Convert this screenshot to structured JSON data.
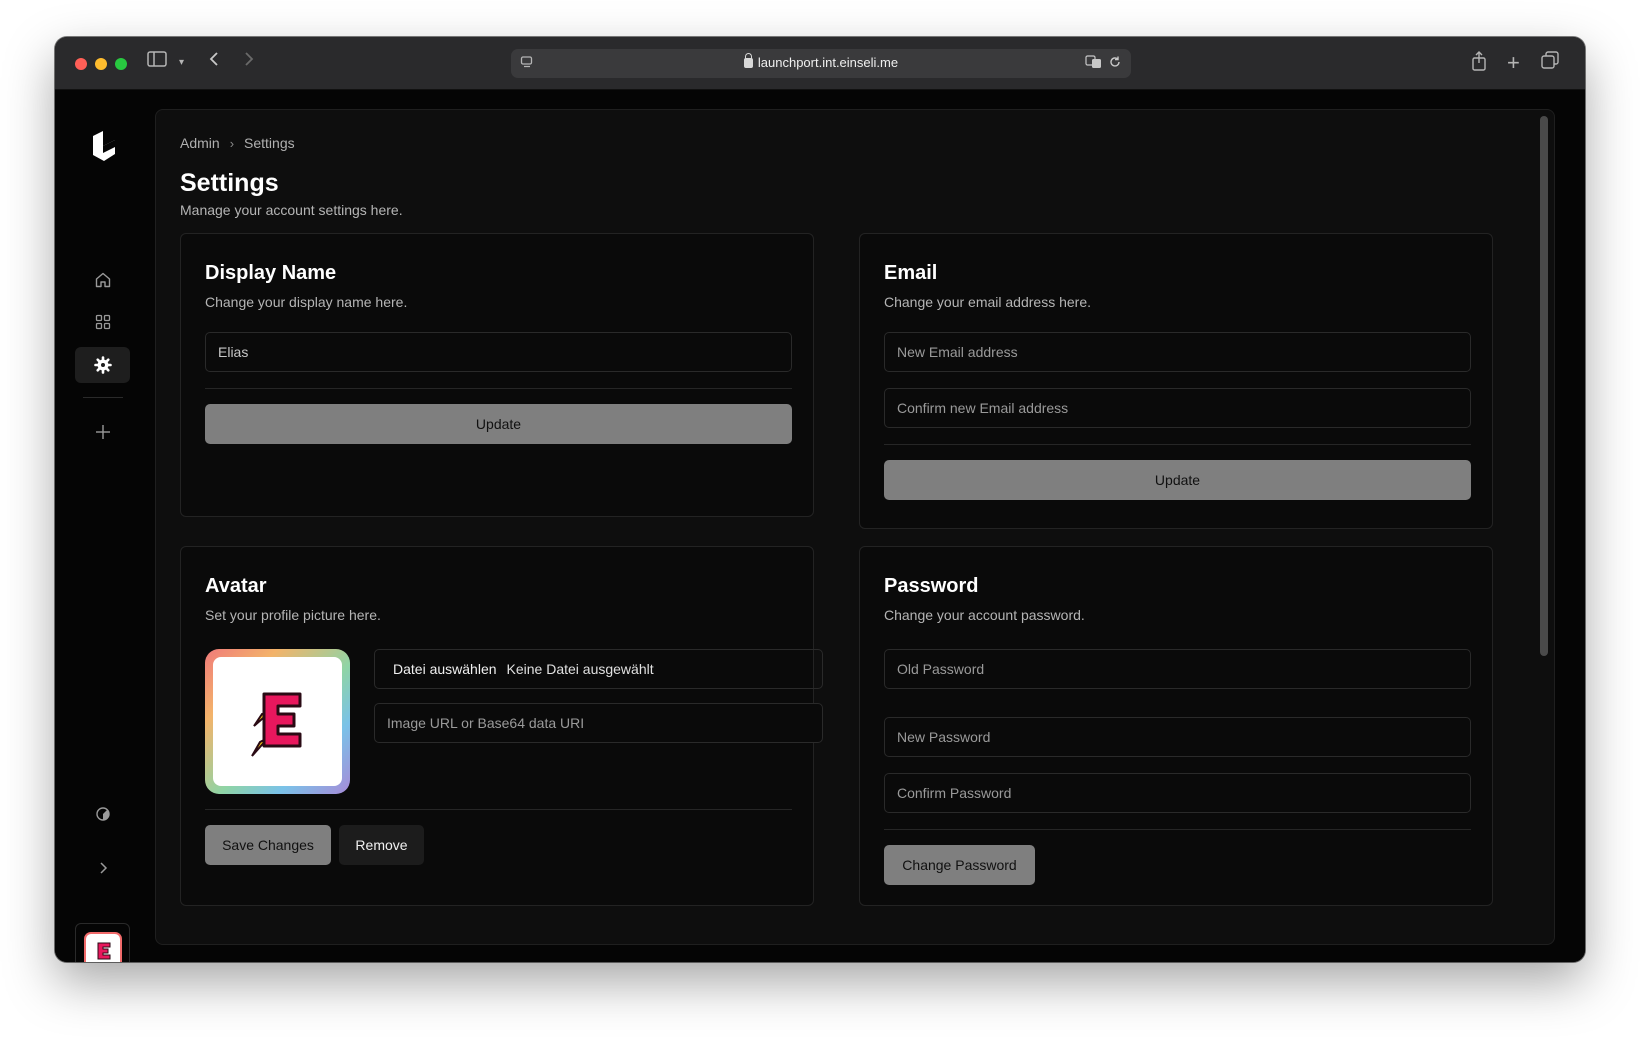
{
  "browser": {
    "url": "launchport.int.einseli.me"
  },
  "breadcrumb": {
    "items": [
      "Admin",
      "Settings"
    ],
    "separator": "›"
  },
  "page": {
    "title": "Settings",
    "subtitle": "Manage your account settings here."
  },
  "display_name_card": {
    "title": "Display Name",
    "subtitle": "Change your display name here.",
    "name_value": "Elias",
    "update_label": "Update"
  },
  "email_card": {
    "title": "Email",
    "subtitle": "Change your email address here.",
    "new_email_placeholder": "New Email address",
    "confirm_email_placeholder": "Confirm new Email address",
    "update_label": "Update"
  },
  "avatar_card": {
    "title": "Avatar",
    "subtitle": "Set your profile picture here.",
    "choose_file_label": "Datei auswählen",
    "no_file_label": "Keine Datei ausgewählt",
    "url_placeholder": "Image URL or Base64 data URI",
    "save_label": "Save Changes",
    "remove_label": "Remove"
  },
  "password_card": {
    "title": "Password",
    "subtitle": "Change your account password.",
    "old_placeholder": "Old Password",
    "new_placeholder": "New Password",
    "confirm_placeholder": "Confirm Password",
    "change_label": "Change Password"
  },
  "sidebar": {
    "items": [
      "home-icon",
      "grid-icon",
      "settings-gear-icon",
      "plus-icon",
      "theme-icon",
      "chevron-right-icon"
    ]
  },
  "colors": {
    "button_primary": "#7f7f7f",
    "background": "#0a0a0a",
    "avatar_brand": "#e8175d"
  }
}
